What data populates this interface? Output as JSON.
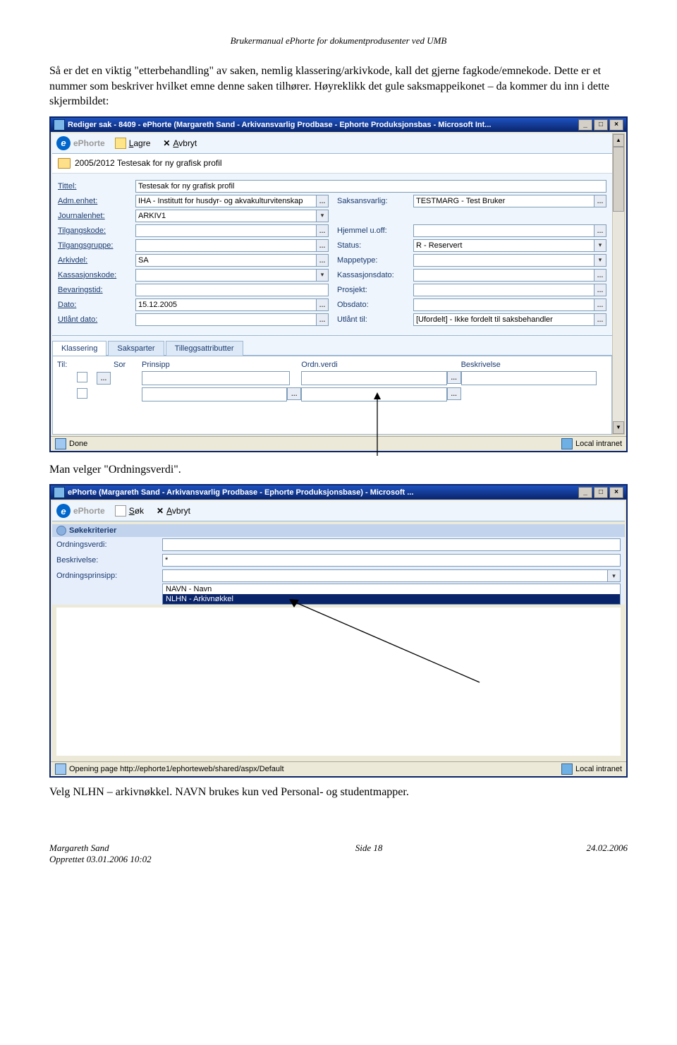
{
  "header": "Brukermanual ePhorte for dokumentprodusenter ved UMB",
  "para1": "Så er det en viktig \"etterbehandling\" av saken, nemlig klassering/arkivkode, kall det gjerne fagkode/emnekode. Dette er et nummer som beskriver hvilket emne denne saken tilhører. Høyreklikk det gule saksmappeikonet – da kommer du inn i dette skjermbildet:",
  "para2": "Man velger \"Ordningsverdi\".",
  "para3": "Velg NLHN – arkivnøkkel. NAVN brukes kun ved Personal- og studentmapper.",
  "win1": {
    "title": "Rediger sak - 8409 - ePhorte (Margareth Sand - Arkivansvarlig Prodbase - Ephorte Produksjonsbas - Microsoft Int...",
    "toolbar": {
      "brand": "ePhorte",
      "save": "Lagre",
      "cancel": "Avbryt"
    },
    "case": "2005/2012  Testesak for ny grafisk profil",
    "labels": {
      "tittel": "Tittel:",
      "adm": "Adm.enhet:",
      "journal": "Journalenhet:",
      "tilgkode": "Tilgangskode:",
      "tilggruppe": "Tilgangsgruppe:",
      "arkivdel": "Arkivdel:",
      "kasskode": "Kassasjonskode:",
      "bevtid": "Bevaringstid:",
      "dato": "Dato:",
      "utlaantdato": "Utlånt dato:",
      "saksansv": "Saksansvarlig:",
      "hjemmel": "Hjemmel u.off:",
      "status": "Status:",
      "mappetype": "Mappetype:",
      "kassdato": "Kassasjonsdato:",
      "prosjekt": "Prosjekt:",
      "obsdato": "Obsdato:",
      "utlaanttil": "Utlånt til:"
    },
    "values": {
      "tittel": "Testesak for ny grafisk profil",
      "adm": "IHA - Institutt for husdyr- og akvakulturvitenskap",
      "journal": "ARKIV1",
      "tilgkode": "",
      "tilggruppe": "",
      "arkivdel": "SA",
      "kasskode": "",
      "bevtid": "",
      "dato": "15.12.2005",
      "utlaantdato": "",
      "saksansv": "TESTMARG - Test Bruker",
      "hjemmel": "",
      "status": "R - Reservert",
      "mappetype": "",
      "kassdato": "",
      "prosjekt": "",
      "obsdato": "",
      "utlaanttil": "[Ufordelt] - Ikke fordelt til saksbehandler"
    },
    "tabs": {
      "klass": "Klassering",
      "saksp": "Saksparter",
      "tillegg": "Tilleggsattributter"
    },
    "grid": {
      "til": "Til:",
      "sor": "Sor",
      "prinsipp": "Prinsipp",
      "ordn": "Ordn.verdi",
      "besk": "Beskrivelse"
    },
    "status": {
      "done": "Done",
      "zone": "Local intranet"
    }
  },
  "win2": {
    "title": "ePhorte (Margareth Sand - Arkivansvarlig Prodbase - Ephorte Produksjonsbase) - Microsoft ...",
    "toolbar": {
      "brand": "ePhorte",
      "search": "Søk",
      "cancel": "Avbryt"
    },
    "crit_head": "Søkekriterier",
    "labels": {
      "ordn": "Ordningsverdi:",
      "besk": "Beskrivelse:",
      "prinsipp": "Ordningsprinsipp:"
    },
    "values": {
      "ordn": "",
      "besk": "*",
      "prinsipp": ""
    },
    "dropdown": {
      "opt1": "NAVN - Navn",
      "opt2": "NLHN - Arkivnøkkel"
    },
    "status": {
      "text": "Opening page http://ephorte1/ephorteweb/shared/aspx/Default",
      "zone": "Local intranet"
    }
  },
  "footer": {
    "name": "Margareth Sand",
    "created": "Opprettet 03.01.2006 10:02",
    "page": "Side 18",
    "date": "24.02.2006"
  }
}
